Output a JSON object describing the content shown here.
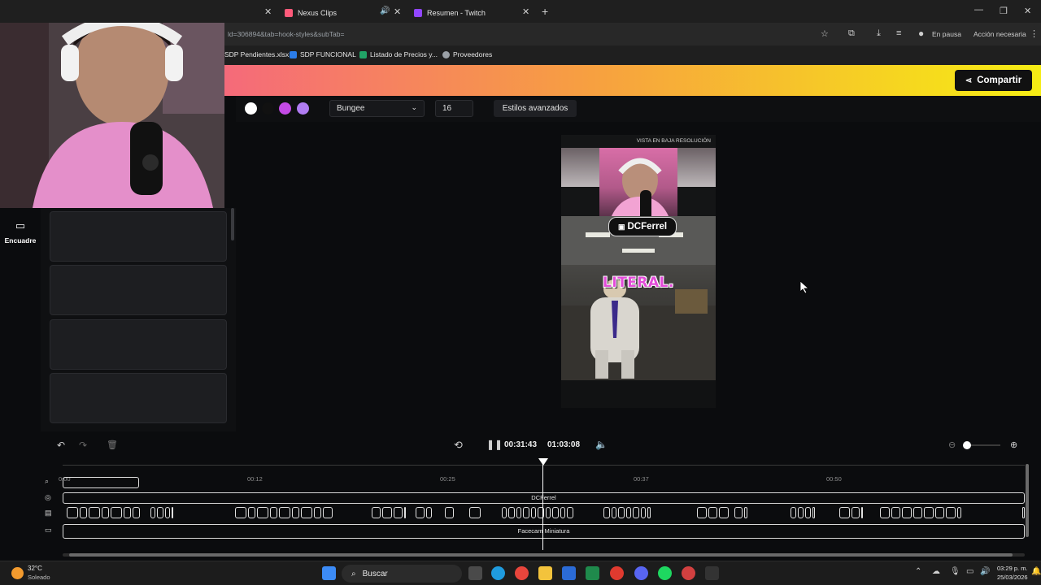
{
  "browser": {
    "tabs": [
      {
        "label": "Nexus Clips",
        "active": true
      },
      {
        "label": "Resumen - Twitch",
        "active": false
      }
    ],
    "url": "ld=306894&tab=hook-styles&subTab=",
    "profile_label": "En pausa",
    "action_label": "Acción necesaria",
    "bookmarks": [
      "SDP Pendientes.xlsx",
      "SDP FUNCIONAL",
      "Listado de Precios y...",
      "Proveedores"
    ]
  },
  "header": {
    "share_label": "Compartir"
  },
  "toolbar": {
    "colors": [
      "#ffffff",
      "#111111",
      "#c44ae6",
      "#b07cf2"
    ],
    "font_value": "Bungee",
    "size_value": "16",
    "advanced_label": "Estilos avanzados"
  },
  "left_rail": {
    "frame_label": "Encuadre"
  },
  "preview": {
    "low_res_label": "VISTA EN BAJA RESOLUCIÓN",
    "channel_name": "DCFerrel",
    "caption": "LITERAL."
  },
  "playback": {
    "current_time": "00:31:43",
    "total_time": "01:03:08"
  },
  "timeline": {
    "ticks": [
      "0:00",
      "00:12",
      "00:25",
      "00:37",
      "00:50"
    ],
    "track_dcferrel_label": "DCFerrel",
    "track_facecam_label": "Facecam Miniatura"
  },
  "taskbar": {
    "weather_temp": "32°C",
    "weather_desc": "Soleado",
    "search_label": "Buscar",
    "time": "03:29 p. m.",
    "date": "25/03/2026"
  }
}
